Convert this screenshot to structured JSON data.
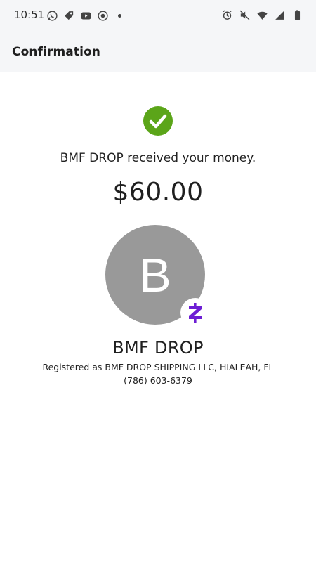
{
  "status_bar": {
    "time": "10:51",
    "left_icons": [
      "whatsapp-icon",
      "tag-icon",
      "youtube-icon",
      "target-icon"
    ],
    "right_icons": [
      "alarm-icon",
      "mute-icon",
      "wifi-icon",
      "signal-icon",
      "battery-icon"
    ]
  },
  "app_bar": {
    "title": "Confirmation"
  },
  "confirmation": {
    "icon": "check-circle-icon",
    "message": "BMF DROP received your money.",
    "amount": "$60.00"
  },
  "recipient": {
    "avatar_initial": "B",
    "badge_icon": "zelle-z-icon",
    "name": "BMF DROP",
    "registered": "Registered as BMF DROP SHIPPING LLC, HIALEAH, FL",
    "phone": "(786) 603-6379"
  },
  "colors": {
    "success": "#5ba519",
    "zelle_purple": "#6d1ed4",
    "avatar_gray": "#999999",
    "header_bg": "#f5f6f8"
  }
}
